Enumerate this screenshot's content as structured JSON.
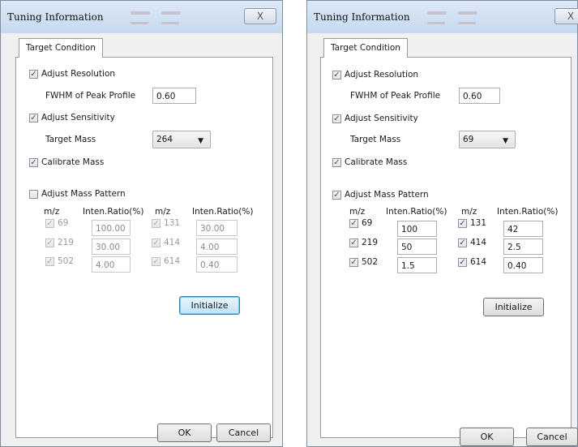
{
  "left_dialog": {
    "title": "Tuning Information",
    "close_glyph": "X",
    "tab": "Target Condition",
    "adjust_resolution": "Adjust Resolution",
    "fwhm_label": "FWHM of Peak Profile",
    "fwhm_value": "0.60",
    "adjust_sensitivity": "Adjust Sensitivity",
    "target_mass_label": "Target Mass",
    "target_mass_value": "264",
    "calibrate_mass": "Calibrate Mass",
    "adjust_mass_pattern": "Adjust Mass Pattern",
    "col_mz": "m/z",
    "col_ratio": "Inten.Ratio(%)",
    "rows": [
      {
        "mz1": "69",
        "r1": "100.00",
        "mz2": "131",
        "r2": "30.00"
      },
      {
        "mz1": "219",
        "r1": "30.00",
        "mz2": "414",
        "r2": "4.00"
      },
      {
        "mz1": "502",
        "r1": "4.00",
        "mz2": "614",
        "r2": "0.40"
      }
    ],
    "initialize": "Initialize",
    "ok": "OK",
    "cancel": "Cancel",
    "checked": {
      "adjust_resolution": true,
      "adjust_sensitivity": true,
      "calibrate_mass": true,
      "adjust_mass_pattern": false
    }
  },
  "right_dialog": {
    "title": "Tuning Information",
    "close_glyph": "X",
    "tab": "Target Condition",
    "adjust_resolution": "Adjust Resolution",
    "fwhm_label": "FWHM of Peak Profile",
    "fwhm_value": "0.60",
    "adjust_sensitivity": "Adjust Sensitivity",
    "target_mass_label": "Target Mass",
    "target_mass_value": "69",
    "calibrate_mass": "Calibrate Mass",
    "adjust_mass_pattern": "Adjust Mass Pattern",
    "col_mz": "m/z",
    "col_ratio": "Inten.Ratio(%)",
    "rows": [
      {
        "mz1": "69",
        "r1": "100",
        "mz2": "131",
        "r2": "42"
      },
      {
        "mz1": "219",
        "r1": "50",
        "mz2": "414",
        "r2": "2.5"
      },
      {
        "mz1": "502",
        "r1": "1.5",
        "mz2": "614",
        "r2": "0.40"
      }
    ],
    "initialize": "Initialize",
    "ok": "OK",
    "cancel": "Cancel",
    "checked": {
      "adjust_resolution": true,
      "adjust_sensitivity": true,
      "calibrate_mass": true,
      "adjust_mass_pattern": true
    }
  },
  "colors": {
    "titlebar": "#c5d9ef",
    "panel": "#ffffff",
    "focus_border": "#3c7fb1"
  },
  "icons": {
    "check": "checkmark-icon",
    "dropdown": "chevron-down-icon",
    "close": "close-icon"
  }
}
